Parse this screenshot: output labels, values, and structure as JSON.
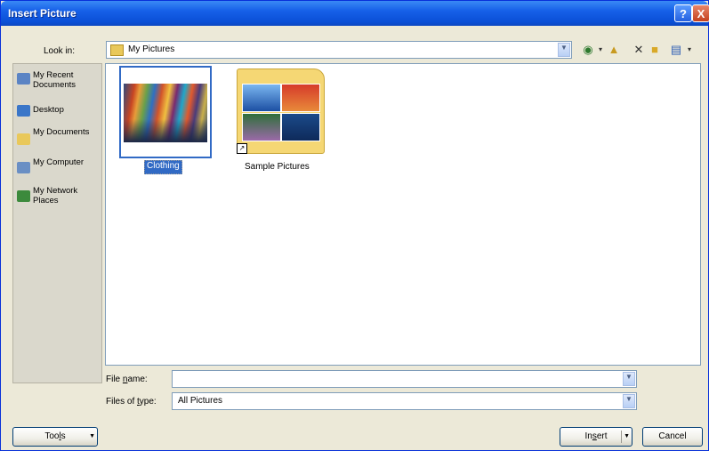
{
  "window": {
    "title": "Insert Picture",
    "help_label": "?",
    "close_label": "X"
  },
  "lookin": {
    "label": "Look in:",
    "value": "My Pictures"
  },
  "places": [
    {
      "name": "places-my-recent-documents",
      "label": "My Recent Documents",
      "icon": "recent-documents-icon",
      "color": "#5b84c4"
    },
    {
      "name": "places-desktop",
      "label": "Desktop",
      "icon": "desktop-icon",
      "color": "#3a76c8"
    },
    {
      "name": "places-my-documents",
      "label": "My Documents",
      "icon": "my-documents-icon",
      "color": "#e9c85a"
    },
    {
      "name": "places-my-computer",
      "label": "My Computer",
      "icon": "my-computer-icon",
      "color": "#6a8fc4"
    },
    {
      "name": "places-my-network-places",
      "label": "My Network Places",
      "icon": "network-places-icon",
      "color": "#3c8a3c"
    }
  ],
  "files": [
    {
      "name": "Clothing",
      "kind": "image",
      "selected": true
    },
    {
      "name": "Sample Pictures",
      "kind": "folder-shortcut",
      "selected": false
    }
  ],
  "filename": {
    "label_prefix": "File ",
    "label_access": "n",
    "label_suffix": "ame:",
    "value": ""
  },
  "filetype": {
    "label_prefix": "Files of ",
    "label_access": "t",
    "label_suffix": "ype:",
    "value": "All Pictures"
  },
  "buttons": {
    "tools_prefix": "Too",
    "tools_access": "l",
    "tools_suffix": "s",
    "insert_prefix": "In",
    "insert_access": "s",
    "insert_suffix": "ert",
    "cancel": "Cancel"
  },
  "toolbar_icons": [
    "back-icon",
    "up-folder-icon",
    "delete-icon",
    "new-folder-icon",
    "views-icon"
  ],
  "colors": {
    "title_bar": "#0a4fd6",
    "selection": "#316ac5",
    "dialog_bg": "#ece9d8"
  }
}
